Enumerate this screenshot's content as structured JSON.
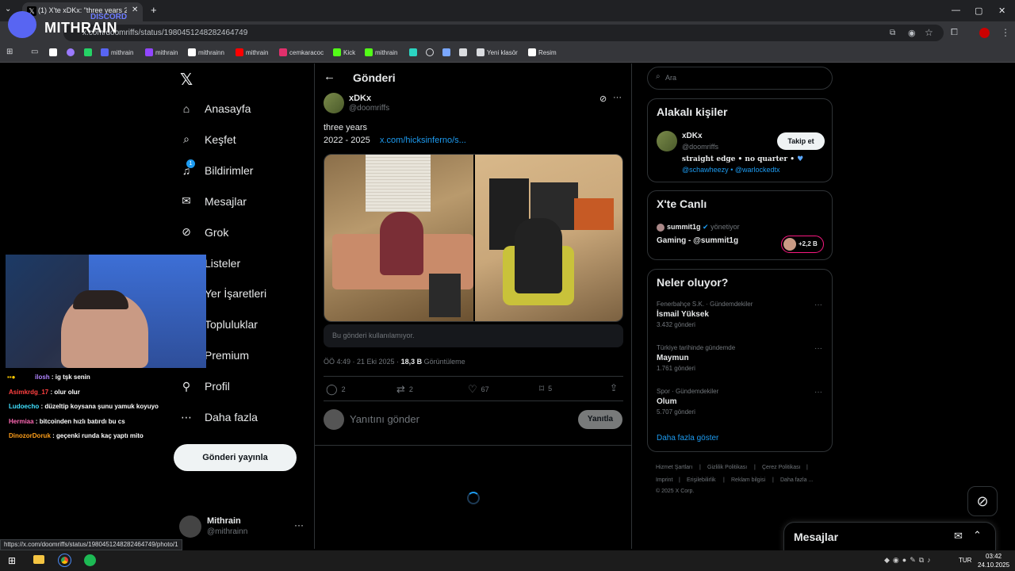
{
  "browser": {
    "tab_title": "(1) X'te xDKx: \"three years 2022",
    "url": "x.com/doomriffs/status/1980451248282464749",
    "bookmarks": [
      {
        "label": "mithrain",
        "color": "#5865f2"
      },
      {
        "label": "mithrain",
        "color": "#9146ff"
      },
      {
        "label": "mithrainn",
        "color": "#ffffff"
      },
      {
        "label": "mithrain",
        "color": "#ff0000"
      },
      {
        "label": "cemkaracoc",
        "color": "#e1306c"
      },
      {
        "label": "Kick",
        "color": "#53fc18"
      },
      {
        "label": "mithrain",
        "color": "#53fc18"
      },
      {
        "label": "Yeni klasör",
        "color": "#dadce0"
      },
      {
        "label": "Resim",
        "color": "#ffffff"
      }
    ],
    "status_url": "https://x.com/doomriffs/status/1980451248282464749/photo/1"
  },
  "overlay": {
    "discord_label": "DISCORD",
    "discord_name": "MITHRAIN",
    "chat": [
      {
        "user": "ilosh",
        "msg": "ig tşk senin",
        "color": "#b084ff"
      },
      {
        "user": "Asimkrdg_17",
        "msg": "olur olur",
        "color": "#ff4040"
      },
      {
        "user": "Ludoecho",
        "msg": "düzeltip koysana şunu yamuk koyuyo",
        "color": "#40e0ff"
      },
      {
        "user": "Hermiaa",
        "msg": "bitcoinden hızlı batırdı bu cs",
        "color": "#ff69b4"
      },
      {
        "user": "DinozorDoruk",
        "msg": "geçenki runda kaç yaptı mito",
        "color": "#ff9f1a"
      }
    ]
  },
  "nav": {
    "items": [
      {
        "label": "Anasayfa",
        "icon": "home-icon"
      },
      {
        "label": "Keşfet",
        "icon": "search-icon"
      },
      {
        "label": "Bildirimler",
        "icon": "bell-icon",
        "badge": "1"
      },
      {
        "label": "Mesajlar",
        "icon": "mail-icon"
      },
      {
        "label": "Grok",
        "icon": "grok-icon"
      },
      {
        "label": "Listeler",
        "icon": "list-icon"
      },
      {
        "label": "Yer İşaretleri",
        "icon": "bookmark-icon"
      },
      {
        "label": "Topluluklar",
        "icon": "people-icon"
      },
      {
        "label": "Premium",
        "icon": "x-icon"
      },
      {
        "label": "Profil",
        "icon": "profile-icon"
      },
      {
        "label": "Daha fazla",
        "icon": "more-icon"
      }
    ],
    "post_button": "Gönderi yayınla",
    "account": {
      "name": "Mithrain",
      "handle": "@mithrainn"
    }
  },
  "post": {
    "header_title": "Gönderi",
    "author_name": "xDKx",
    "author_handle": "@doomriffs",
    "text_line1": "three years",
    "text_line2": "2022 - 2025",
    "link": "x.com/hicksinferno/s...",
    "unavailable": "Bu gönderi kullanılamıyor.",
    "time": "ÖÖ 4:49 · 21 Eki 2025 ·",
    "views": "18,3 B",
    "views_label": "Görüntüleme",
    "replies": "2",
    "reposts": "2",
    "likes": "67",
    "bookmarks": "5",
    "reply_placeholder": "Yanıtını gönder",
    "reply_button": "Yanıtla"
  },
  "sidebar": {
    "search_placeholder": "Ara",
    "related_title": "Alakalı kişiler",
    "related_name": "xDKx",
    "related_handle": "@doomriffs",
    "follow_button": "Takip et",
    "related_bio": "straight edge • no quarter •",
    "related_mentions_a": "@schawheezy",
    "related_mentions_sep": "•",
    "related_mentions_b": "@warlockedtx",
    "live_title": "X'te Canlı",
    "live_host": "summit1g",
    "live_status": "yönetiyor",
    "live_stream": "Gaming - @summit1g",
    "live_count": "+2,2 B",
    "trends_title": "Neler oluyor?",
    "trends": [
      {
        "category": "Fenerbahçe S.K. · Gündemdekiler",
        "name": "İsmail Yüksek",
        "count": "3.432 gönderi"
      },
      {
        "category": "Türkiye tarihinde gündemde",
        "name": "Maymun",
        "count": "1.761 gönderi"
      },
      {
        "category": "Spor · Gündemdekiler",
        "name": "Olum",
        "count": "5.707 gönderi"
      }
    ],
    "show_more": "Daha fazla göster",
    "footer": [
      "Hizmet Şartları",
      "Gizlilik Politikası",
      "Çerez Politikası",
      "Imprint",
      "Erişilebilirlik",
      "Reklam bilgisi",
      "Daha fazla ...",
      "© 2025 X Corp."
    ],
    "messages_label": "Mesajlar"
  },
  "taskbar": {
    "lang": "TUR",
    "time": "03:42",
    "date": "24.10.2025"
  }
}
